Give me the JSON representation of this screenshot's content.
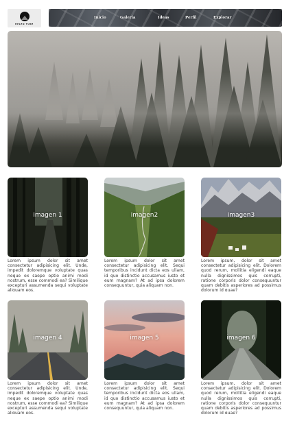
{
  "header": {
    "logo_text": "HELEN TURE",
    "nav": [
      {
        "label": "Inicio"
      },
      {
        "label": "Galeria"
      },
      {
        "label": "Ideas"
      },
      {
        "label": "Perfil"
      },
      {
        "label": "Explorar"
      }
    ]
  },
  "hero": {
    "image_icon": "foggy-forest-image"
  },
  "cards": [
    {
      "title": "imagen 1",
      "text": "Lorem ipsum dolor sit amet consectetur adipisicing elit. Unde, impedit doloremque voluptate quas neque ex saepe optio animi modi nostrum, esse commodi ea? Similique excepturi assumenda sequi voluptate aliquam eos."
    },
    {
      "title": "imagen2",
      "text": "Lorem ipsum dolor sit amet consectetur adipisicing elit. Sequi temporibus incidunt dicta eos ullam, id quo distinctio accusamus iusto et eum magnam? At ad ipsa dolorem consequuntur, quia aliquam non."
    },
    {
      "title": "imagen3",
      "text": "Lorem ipsum, dolor sit amet consectetur adipisicing elit. Dolorem quod rerum, mollitia eligendi eaque nulla dignissimos quis corrupti, ratione corporis dolor consequuntur quam debitis asperiores ad possimus dolorum id quae?"
    },
    {
      "title": "imagen 4",
      "text": "Lorem ipsum dolor sit amet consectetur adipisicing elit. Unde, impedit doloremque voluptate quas neque ex saepe optio animi modi nostrum, esse commodi ea? Similique excepturi assumenda sequi voluptate aliquam eos."
    },
    {
      "title": "imagen 5",
      "text": "Lorem ipsum dolor sit amet consectetur adipisicing elit. Sequi temporibus incidunt dicta eos ullam, id quo distinctio accusamus iusto et eum magnam? At ad ipsa dolorem consequuntur, quia aliquam non."
    },
    {
      "title": "imagen 6",
      "text": "Lorem ipsum, dolor sit amet consectetur adipisicing elit. Dolorem quod rerum, mollitia eligendi eaque nulla dignissimos quis corrupti, ratione corporis dolor consequuntur quam debitis asperiores ad possimus dolorum id quae?"
    }
  ]
}
